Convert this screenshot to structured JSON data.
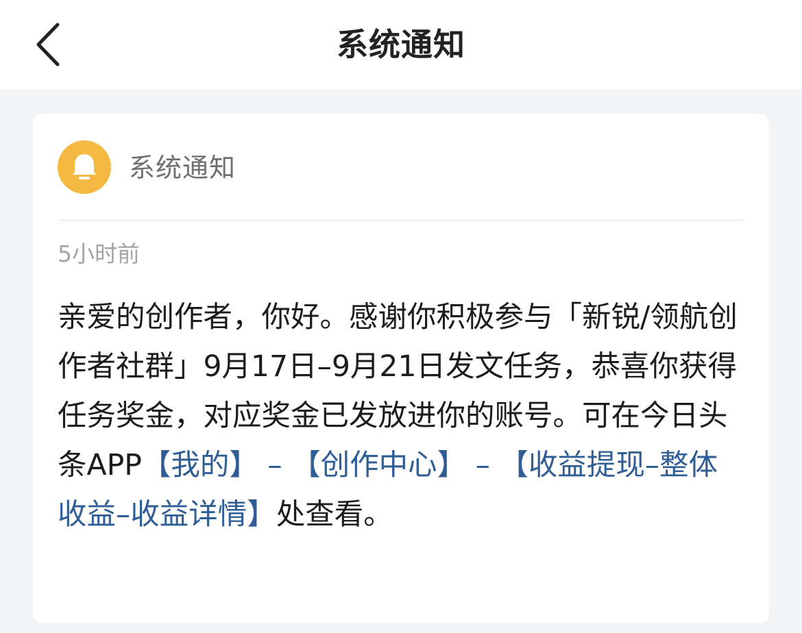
{
  "header": {
    "title": "系统通知",
    "back_icon": "chevron-left-icon"
  },
  "notification": {
    "sender_name": "系统通知",
    "avatar_icon": "bell-icon",
    "avatar_color": "#f5b840",
    "time": "5小时前",
    "body_parts": [
      "亲爱的创作者，你好。感谢你积极参与「新锐/领航创作者社群」9月17日–9月21日发文任务，恭喜你获得任务奖金，对应奖金已发放进你的账号。可在今日头条APP",
      "【我的】 – 【创作中心】 – 【收益提现–整体收益–收益详情】",
      "处查看。"
    ],
    "link_color": "#2f5e96"
  }
}
